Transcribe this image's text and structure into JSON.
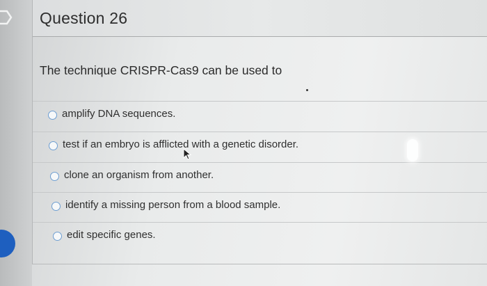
{
  "question": {
    "title": "Question 26",
    "prompt": "The technique CRISPR-Cas9 can be used to",
    "options": [
      {
        "label": "amplify DNA sequences.",
        "selected": false
      },
      {
        "label": "test if an embryo is afflicted with a genetic disorder.",
        "selected": false
      },
      {
        "label": "clone an organism from another.",
        "selected": false
      },
      {
        "label": "identify a missing person from a blood sample.",
        "selected": false
      },
      {
        "label": "edit specific genes.",
        "selected": false
      }
    ]
  },
  "icons": {
    "flag": "flag-icon",
    "cursor": "mouse-pointer-icon"
  },
  "colors": {
    "radio_border": "#6d9ed2",
    "accent_blue": "#1e5fbf"
  }
}
